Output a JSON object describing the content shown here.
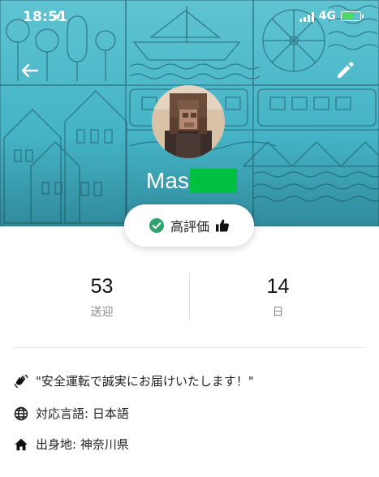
{
  "status_bar": {
    "time": "18:51",
    "network": "4G",
    "battery_level": 0.7,
    "battery_color": "#4cd964"
  },
  "header": {
    "banner_color": "#4fbccc",
    "back_icon": "arrow-left-icon",
    "edit_icon": "pencil-icon"
  },
  "profile": {
    "name_visible": "Mas",
    "name_redaction_color": "#00c040",
    "avatar": "pixelated-avatar"
  },
  "rating": {
    "label": "高評価",
    "check_icon": "check-circle-icon",
    "check_color": "#2fa36b",
    "thumb_icon": "thumbs-up-icon"
  },
  "stats": [
    {
      "value": "53",
      "label": "送迎"
    },
    {
      "value": "14",
      "label": "日"
    }
  ],
  "info": {
    "intro": "\"安全運転で誠実にお届けいたします！\"",
    "language": "対応言語: 日本語",
    "hometown": "出身地: 神奈川県",
    "intro_icon": "waving-hand-icon",
    "language_icon": "globe-icon",
    "hometown_icon": "home-icon"
  }
}
